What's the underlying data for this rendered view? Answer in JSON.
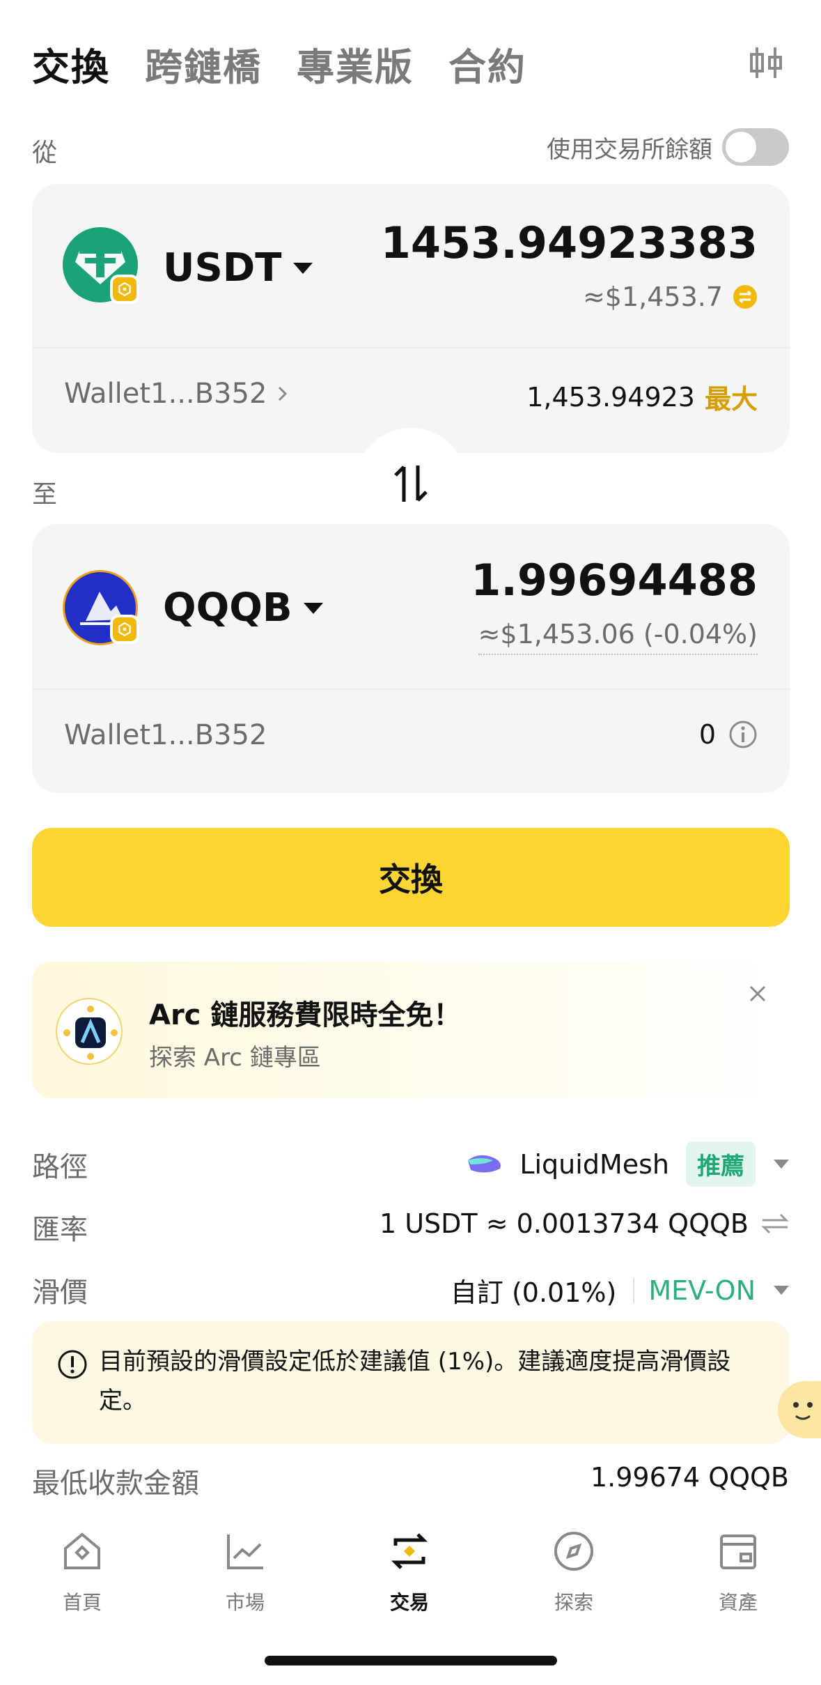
{
  "header": {
    "tabs": [
      {
        "label": "交換",
        "active": true
      },
      {
        "label": "跨鏈橋",
        "active": false
      },
      {
        "label": "專業版",
        "active": false
      },
      {
        "label": "合約",
        "active": false
      }
    ],
    "settings_icon": "candlestick-icon"
  },
  "from": {
    "section_label": "從",
    "use_exchange_balance_label": "使用交易所餘額",
    "use_exchange_balance_on": false,
    "token": "USDT",
    "amount": "1453.94923383",
    "fiat": "≈$1,453.7",
    "wallet": "Wallet1...B352",
    "balance": "1,453.94923",
    "max_label": "最大"
  },
  "to": {
    "section_label": "至",
    "token": "QQQB",
    "amount": "1.99694488",
    "fiat": "≈$1,453.06 (-0.04%)",
    "wallet": "Wallet1...B352",
    "balance": "0"
  },
  "swap_button": "交換",
  "promo": {
    "title": "Arc 鏈服務費限時全免！",
    "subtitle": "探索 Arc 鏈專區"
  },
  "details": {
    "route_label": "路徑",
    "route_value": "LiquidMesh",
    "route_badge": "推薦",
    "rate_label": "匯率",
    "rate_value": "1 USDT ≈ 0.0013734 QQQB",
    "slippage_label": "滑價",
    "slippage_value": "自訂 (0.01%)",
    "mev_label": "MEV-ON",
    "warning": "目前預設的滑價設定低於建議值 (1%)。建議適度提高滑價設定。",
    "min_received_label": "最低收款金額",
    "min_received_value": "1.99674 QQQB"
  },
  "nav": [
    {
      "label": "首頁",
      "icon": "home-icon",
      "active": false
    },
    {
      "label": "市場",
      "icon": "chart-icon",
      "active": false
    },
    {
      "label": "交易",
      "icon": "swap-icon",
      "active": true
    },
    {
      "label": "探索",
      "icon": "compass-icon",
      "active": false
    },
    {
      "label": "資產",
      "icon": "wallet-icon",
      "active": false
    }
  ],
  "colors": {
    "accent": "#fcd535",
    "max": "#d69e00",
    "green": "#1fa774"
  }
}
